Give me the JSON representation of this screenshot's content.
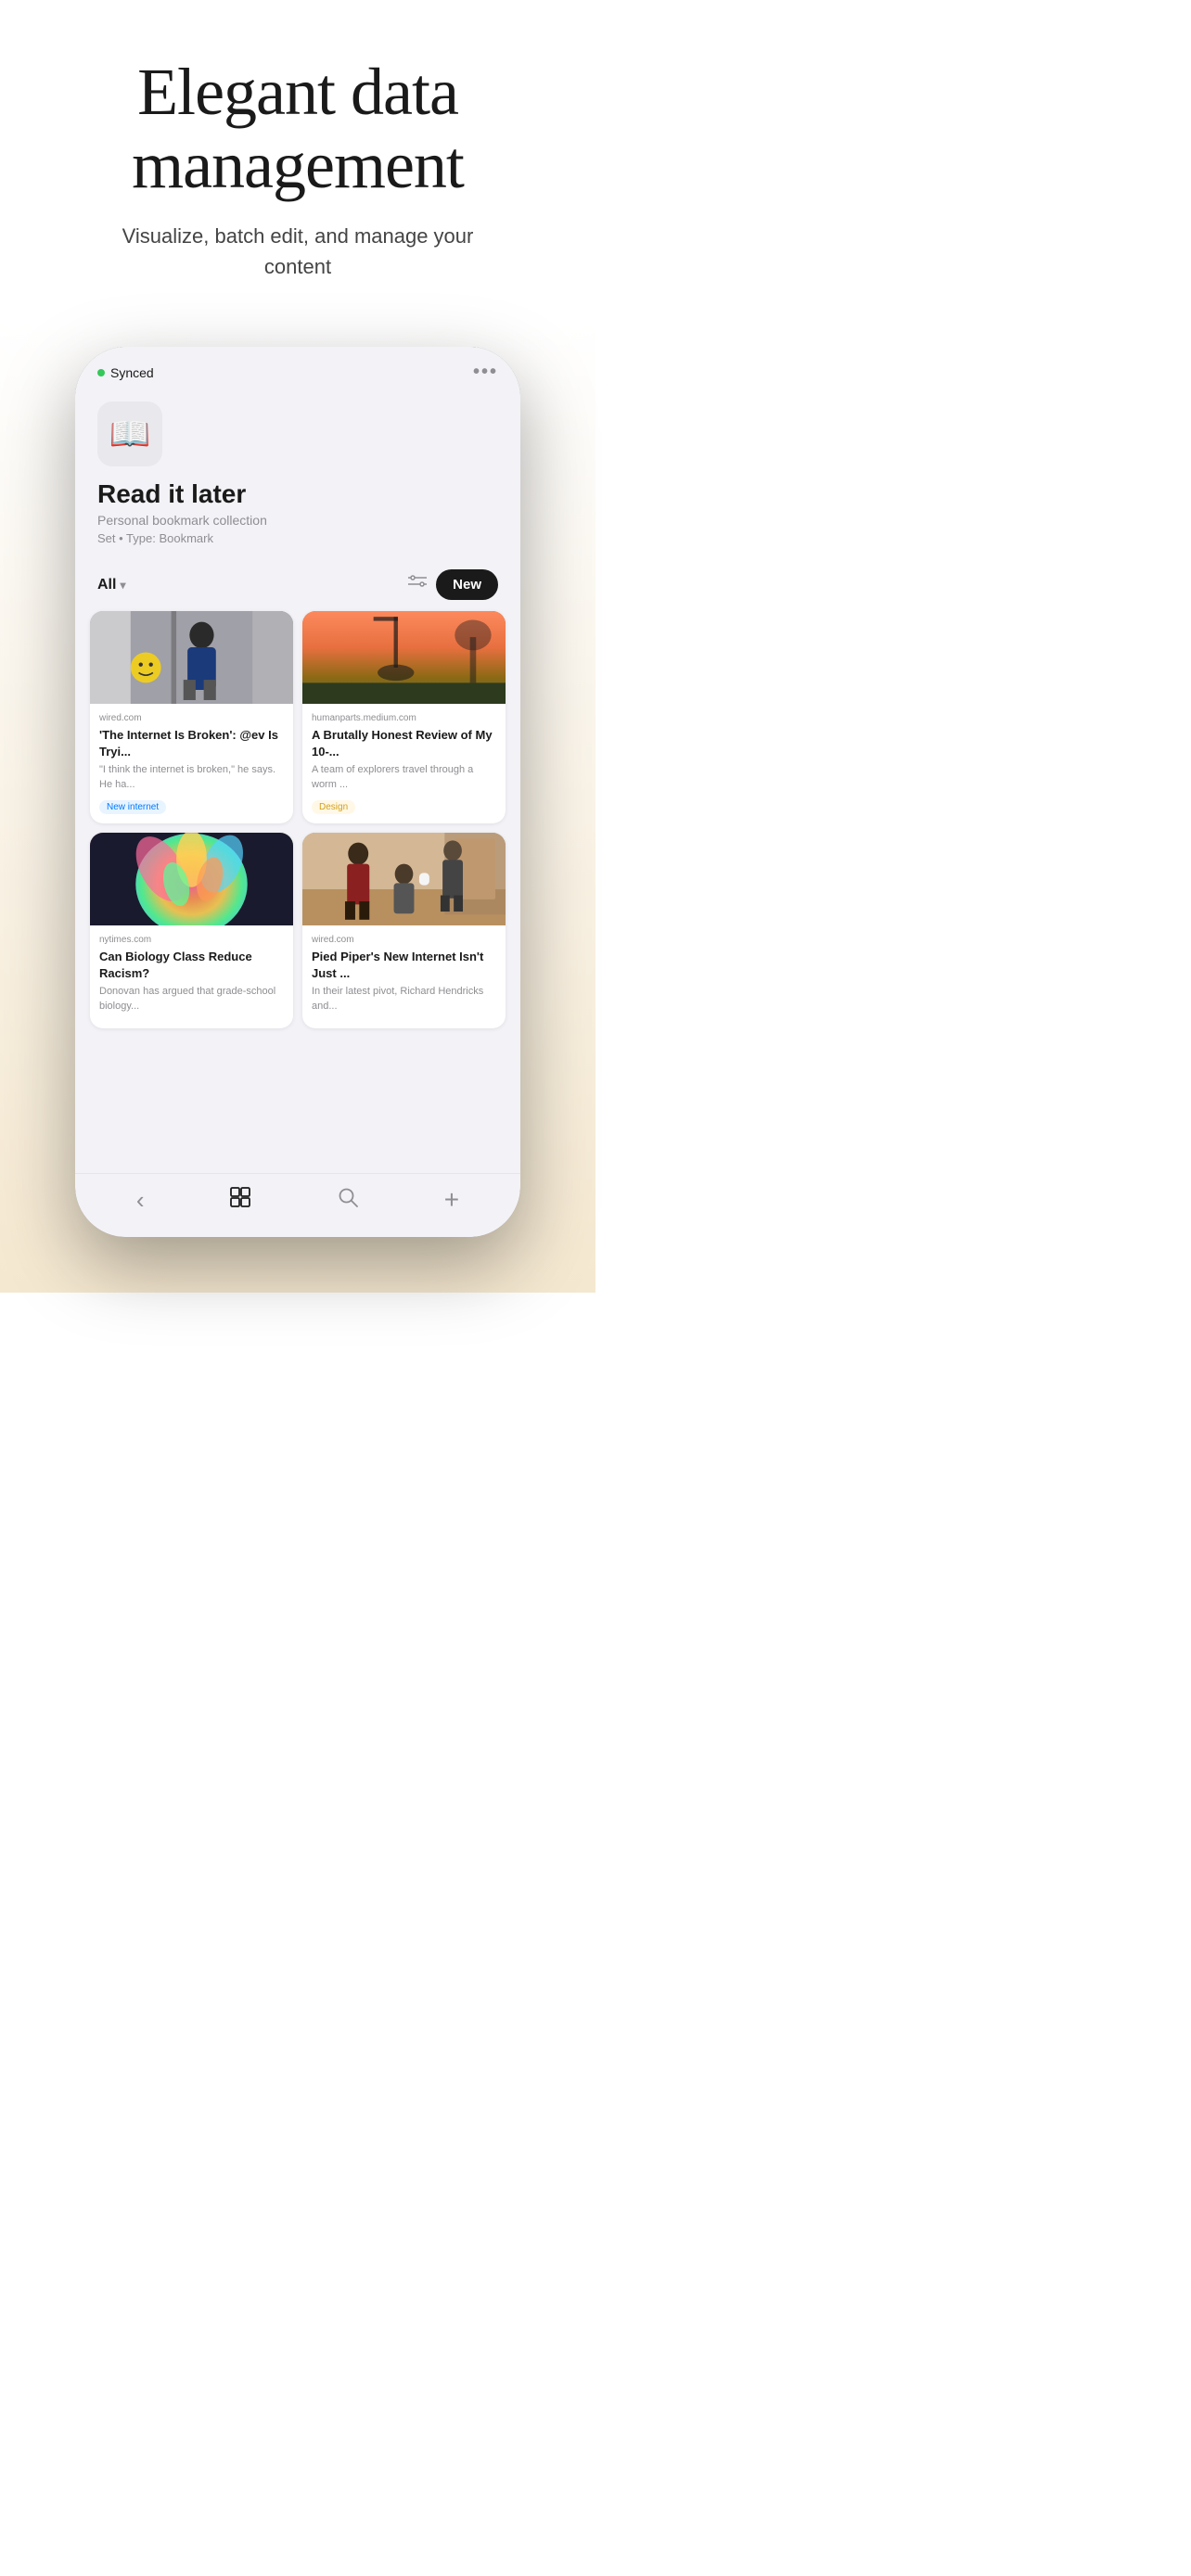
{
  "hero": {
    "title": "Elegant data management",
    "subtitle": "Visualize, batch edit, and manage your content"
  },
  "app": {
    "sync_status": "Synced",
    "sync_dot_color": "#34c759",
    "more_icon": "•••",
    "icon_emoji": "📖",
    "name": "Read it later",
    "description": "Personal bookmark collection",
    "meta": "Set  •  Type: Bookmark",
    "filter_label": "All",
    "new_button_label": "New"
  },
  "cards": [
    {
      "id": 1,
      "source": "wired.com",
      "title": "'The Internet Is Broken': @ev Is Tryi...",
      "excerpt": "\"I think the internet is broken,\" he says. He ha...",
      "tag": "New internet",
      "tag_type": "blue",
      "image_style": "card-image-1"
    },
    {
      "id": 2,
      "source": "humanparts.medium.com",
      "title": "A Brutally Honest Review of My 10-...",
      "excerpt": "A team of explorers travel through a worm ...",
      "tag": "Design",
      "tag_type": "yellow",
      "image_style": "card-image-2"
    },
    {
      "id": 3,
      "source": "nytimes.com",
      "title": "Can Biology Class Reduce Racism?",
      "excerpt": "Donovan has argued that grade-school biology...",
      "tag": "",
      "tag_type": "",
      "image_style": "card-image-3"
    },
    {
      "id": 4,
      "source": "wired.com",
      "title": "Pied Piper's New Internet Isn't Just ...",
      "excerpt": "In their latest pivot, Richard Hendricks and...",
      "tag": "",
      "tag_type": "",
      "image_style": "card-image-4"
    }
  ],
  "bottom_nav": {
    "items": [
      {
        "icon": "‹",
        "label": "back",
        "active": false
      },
      {
        "icon": "⊞",
        "label": "grid",
        "active": false
      },
      {
        "icon": "○",
        "label": "search",
        "active": false
      },
      {
        "icon": "+",
        "label": "add",
        "active": false
      }
    ]
  }
}
